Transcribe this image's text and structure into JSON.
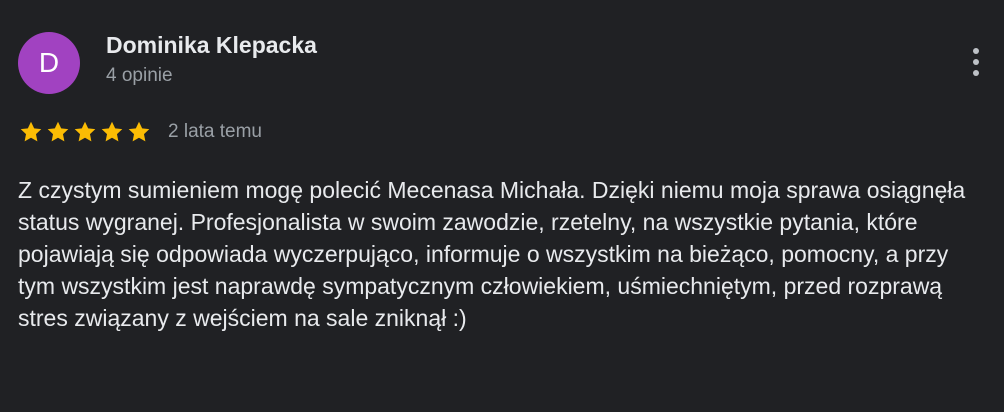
{
  "review": {
    "avatar_letter": "D",
    "avatar_color": "#a142c1",
    "reviewer_name": "Dominika Klepacka",
    "reviewer_meta": "4 opinie",
    "rating": 5,
    "rating_max": 5,
    "star_color": "#fbbc04",
    "date": "2 lata temu",
    "menu_icon": "more-vert-icon",
    "text": "Z czystym sumieniem mogę polecić Mecenasa Michała. Dzięki niemu moja sprawa osiągnęła status wygranej. Profesjonalista w swoim zawodzie, rzetelny, na wszystkie pytania, które pojawiają się odpowiada wyczerpująco, informuje o wszystkim na bieżąco, pomocny, a przy tym wszystkim jest naprawdę sympatycznym człowiekiem, uśmiechniętym, przed rozprawą stres związany z wejściem na sale zniknął :)"
  }
}
